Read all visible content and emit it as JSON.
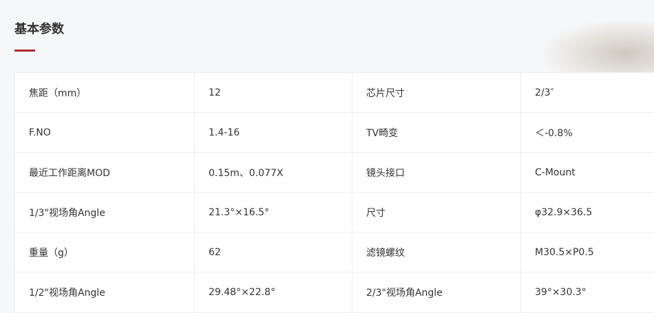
{
  "section": {
    "title": "基本参数"
  },
  "rows": [
    [
      "焦距（mm）",
      "12",
      "芯片尺寸",
      "2/3″"
    ],
    [
      "F.NO",
      "1.4-16",
      "TV畸变",
      "＜-0.8%"
    ],
    [
      "最近工作距离MOD",
      "0.15m、0.077X",
      "镜头接口",
      "C-Mount"
    ],
    [
      "1/3\"视场角Angle",
      "21.3°×16.5°",
      "尺寸",
      "φ32.9×36.5"
    ],
    [
      "重量（g）",
      "62",
      "滤镜螺纹",
      "M30.5×P0.5"
    ],
    [
      "1/2\"视场角Angle",
      "29.48°×22.8°",
      "2/3\"视场角Angle",
      "39°×30.3°"
    ]
  ],
  "colors": {
    "accent": "#b0282c",
    "border": "#ecedef",
    "background": "#f6f7f9"
  }
}
